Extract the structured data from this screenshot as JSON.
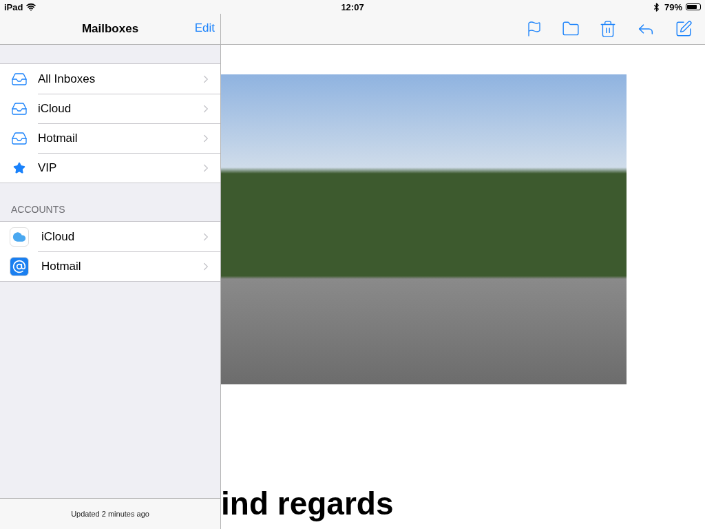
{
  "status_bar": {
    "device": "iPad",
    "time": "12:07",
    "battery": "79%"
  },
  "sidebar": {
    "title": "Mailboxes",
    "edit_button": "Edit",
    "mailboxes": [
      {
        "label": "All Inboxes",
        "kind": "all"
      },
      {
        "label": "iCloud",
        "kind": "inbox"
      },
      {
        "label": "Hotmail",
        "kind": "inbox"
      },
      {
        "label": "VIP",
        "kind": "vip"
      }
    ],
    "accounts_header": "ACCOUNTS",
    "accounts": [
      {
        "label": "iCloud",
        "kind": "cloud"
      },
      {
        "label": "Hotmail",
        "kind": "at"
      }
    ],
    "footer": "Updated 2 minutes ago"
  },
  "message": {
    "closing": "ind regards"
  }
}
